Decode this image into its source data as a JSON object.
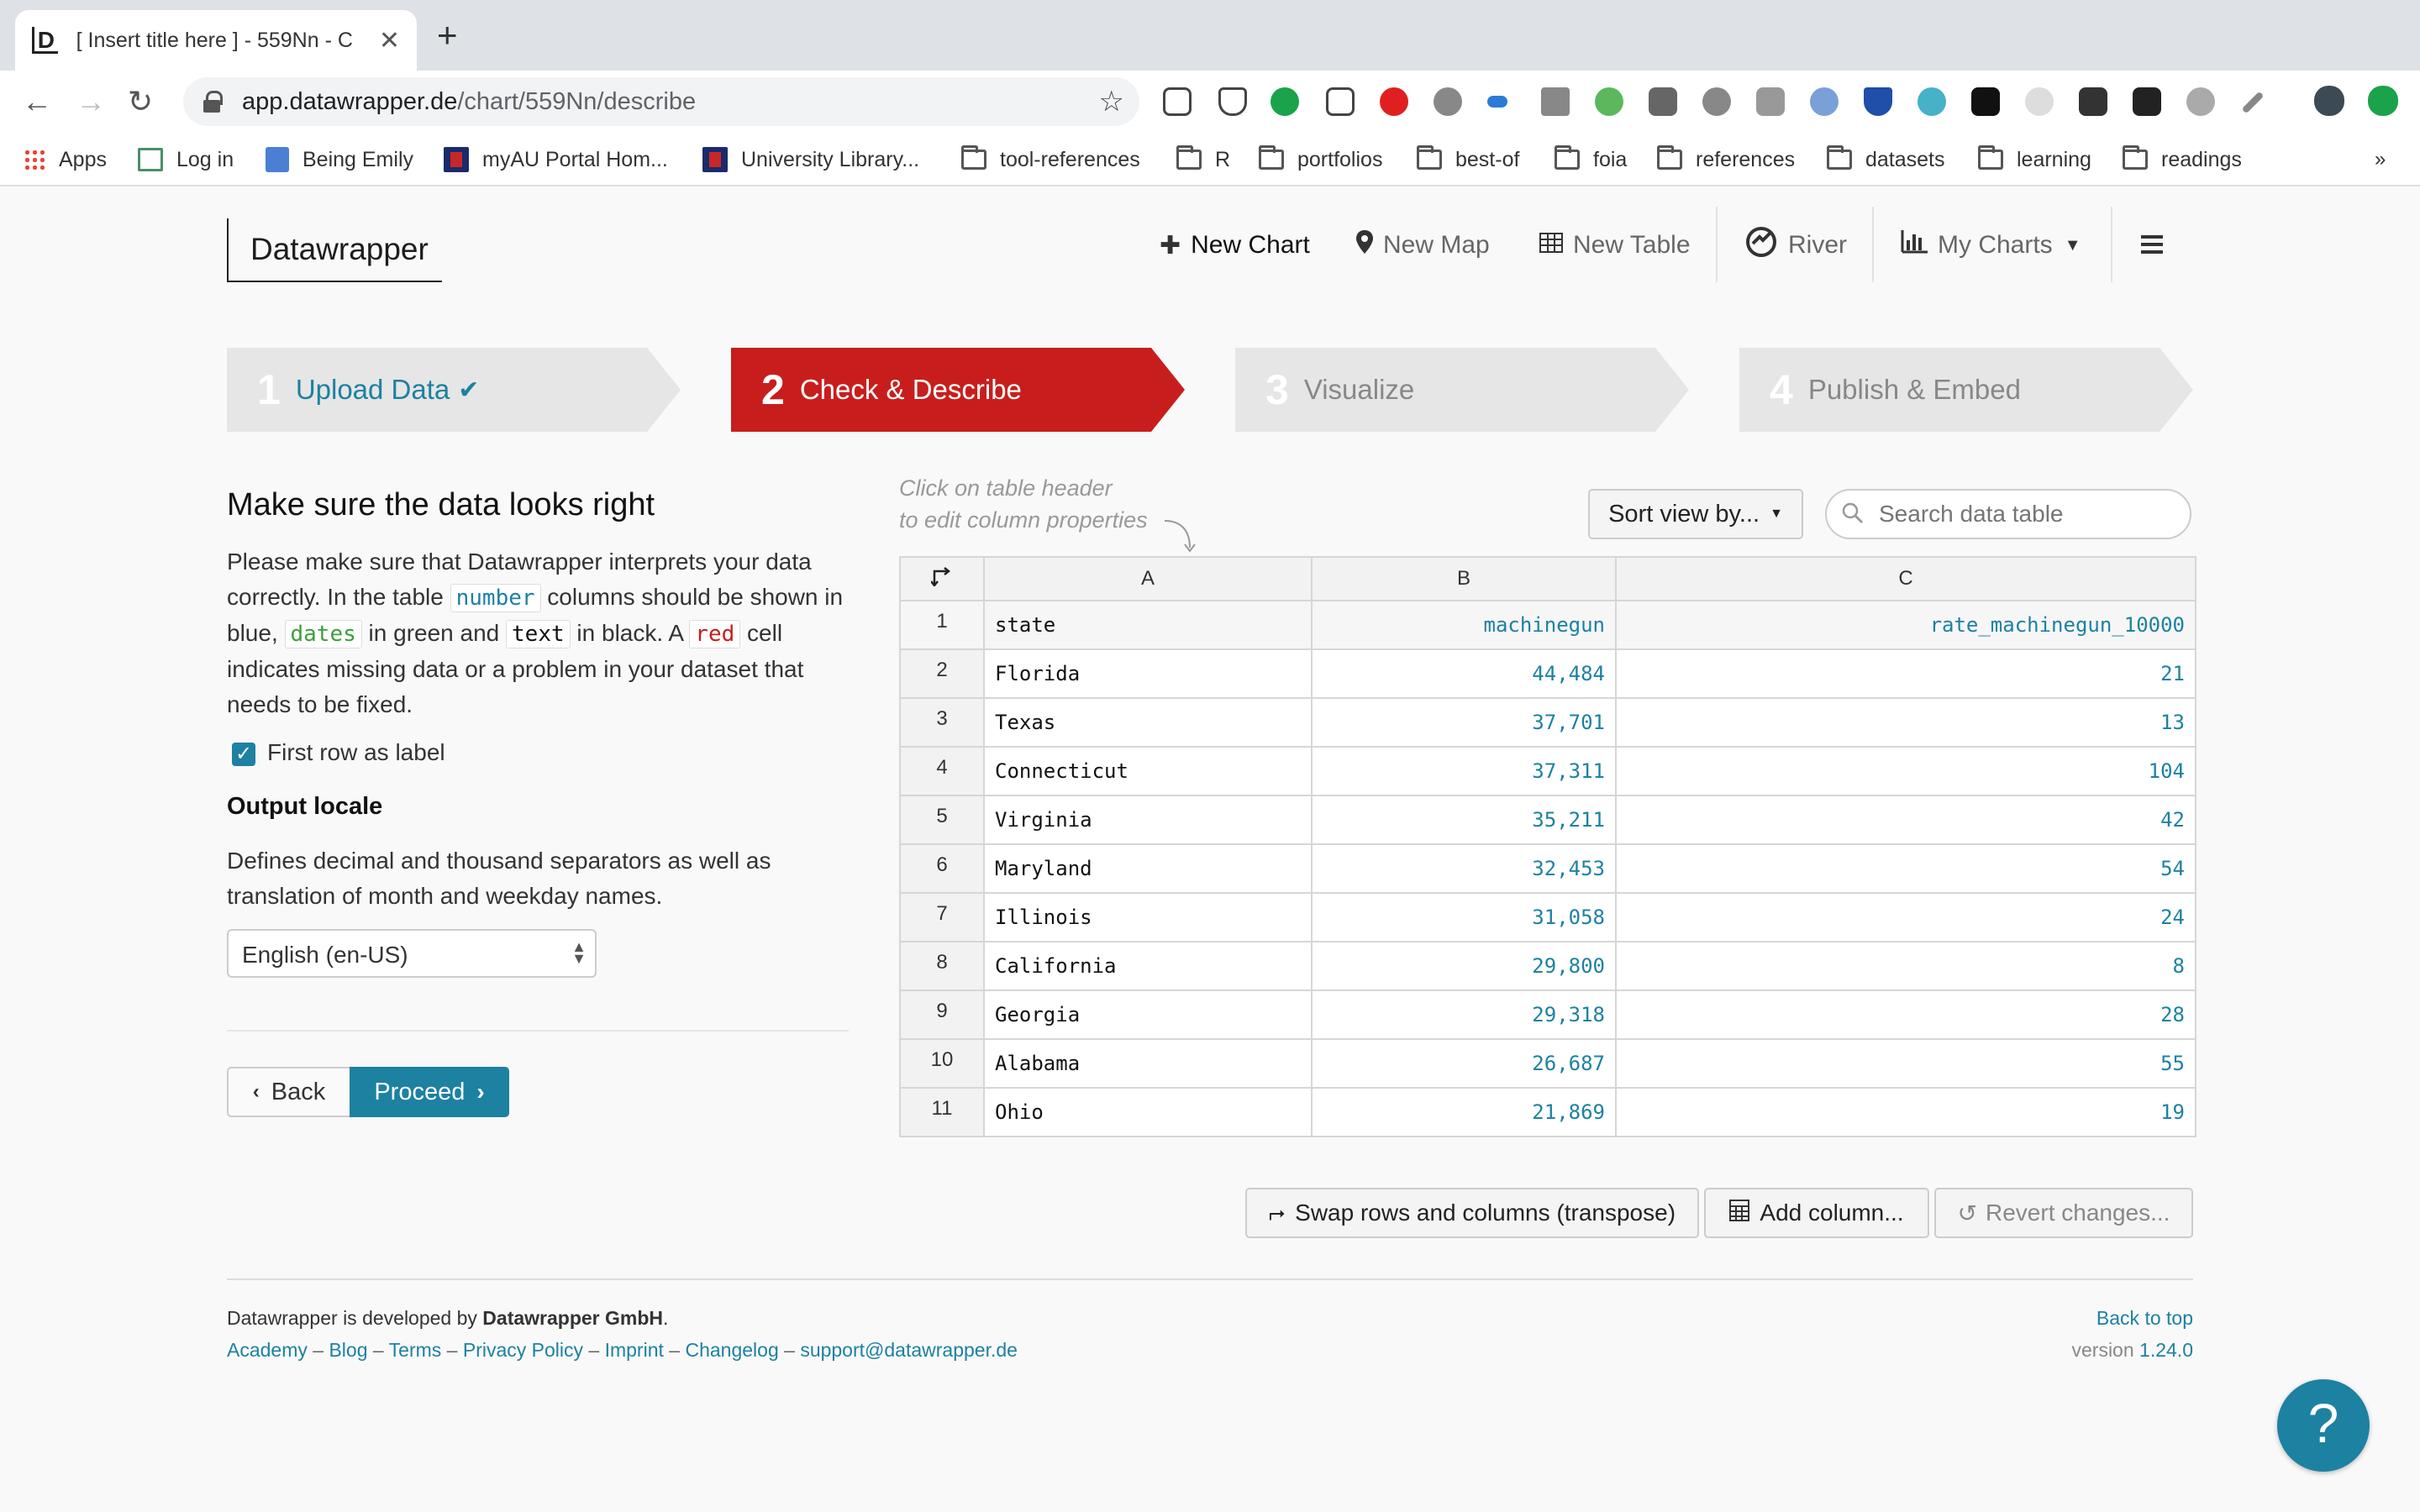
{
  "browser": {
    "tab_title": "[ Insert title here ] - 559Nn - C",
    "url_host": "app.datawrapper.de",
    "url_path": "/chart/559Nn/describe",
    "bookmarks": [
      "Apps",
      "Log in",
      "Being Emily",
      "myAU Portal Hom...",
      "University Library...",
      "tool-references",
      "R",
      "portfolios",
      "best-of",
      "foia",
      "references",
      "datasets",
      "learning",
      "readings"
    ],
    "overflow": "»"
  },
  "app": {
    "logo": "Datawrapper",
    "nav": {
      "new_chart": "New Chart",
      "new_map": "New Map",
      "new_table": "New Table",
      "river": "River",
      "my_charts": "My Charts"
    },
    "steps": [
      {
        "num": "1",
        "label": "Upload Data"
      },
      {
        "num": "2",
        "label": "Check & Describe"
      },
      {
        "num": "3",
        "label": "Visualize"
      },
      {
        "num": "4",
        "label": "Publish & Embed"
      }
    ],
    "colors": {
      "accent": "#1d81a2",
      "active_step": "#c71e1d",
      "step_bg": "#e6e6e6"
    }
  },
  "left": {
    "heading": "Make sure the data looks right",
    "para_a": "Please make sure that Datawrapper interprets your data correctly. In the table ",
    "tok_number": "number",
    "para_b": " columns should be shown in blue, ",
    "tok_dates": "dates",
    "para_c": " in green and ",
    "tok_text": "text",
    "para_d": " in black. A ",
    "tok_red": "red",
    "para_e": " cell indicates missing data or a problem in your dataset that needs to be fixed.",
    "first_row_label": "First row as label",
    "locale_heading": "Output locale",
    "locale_desc": "Defines decimal and thousand separators as well as translation of month and weekday names.",
    "locale_value": "English (en-US)",
    "back": "Back",
    "proceed": "Proceed"
  },
  "table_area": {
    "hint_line1": "Click on table header",
    "hint_line2": "to edit column properties",
    "sort": "Sort view by...",
    "search_placeholder": "Search data table",
    "col_letters": [
      "A",
      "B",
      "C"
    ],
    "row_nums": [
      "1",
      "2",
      "3",
      "4",
      "5",
      "6",
      "7",
      "8",
      "9",
      "10",
      "11"
    ],
    "headers": [
      "state",
      "machinegun",
      "rate_machinegun_10000"
    ],
    "rows": [
      [
        "Florida",
        "44,484",
        "21"
      ],
      [
        "Texas",
        "37,701",
        "13"
      ],
      [
        "Connecticut",
        "37,311",
        "104"
      ],
      [
        "Virginia",
        "35,211",
        "42"
      ],
      [
        "Maryland",
        "32,453",
        "54"
      ],
      [
        "Illinois",
        "31,058",
        "24"
      ],
      [
        "California",
        "29,800",
        "8"
      ],
      [
        "Georgia",
        "29,318",
        "28"
      ],
      [
        "Alabama",
        "26,687",
        "55"
      ],
      [
        "Ohio",
        "21,869",
        "19"
      ]
    ],
    "swap": "Swap rows and columns (transpose)",
    "add_column": "Add column...",
    "revert": "Revert changes..."
  },
  "footer": {
    "dev_prefix": "Datawrapper is developed by ",
    "dev_company": "Datawrapper GmbH",
    "dev_suffix": ".",
    "links": [
      "Academy",
      "Blog",
      "Terms",
      "Privacy Policy",
      "Imprint",
      "Changelog",
      "support@datawrapper.de"
    ],
    "back_to_top": "Back to top",
    "version_label": "version ",
    "version": "1.24.0",
    "help": "?"
  }
}
